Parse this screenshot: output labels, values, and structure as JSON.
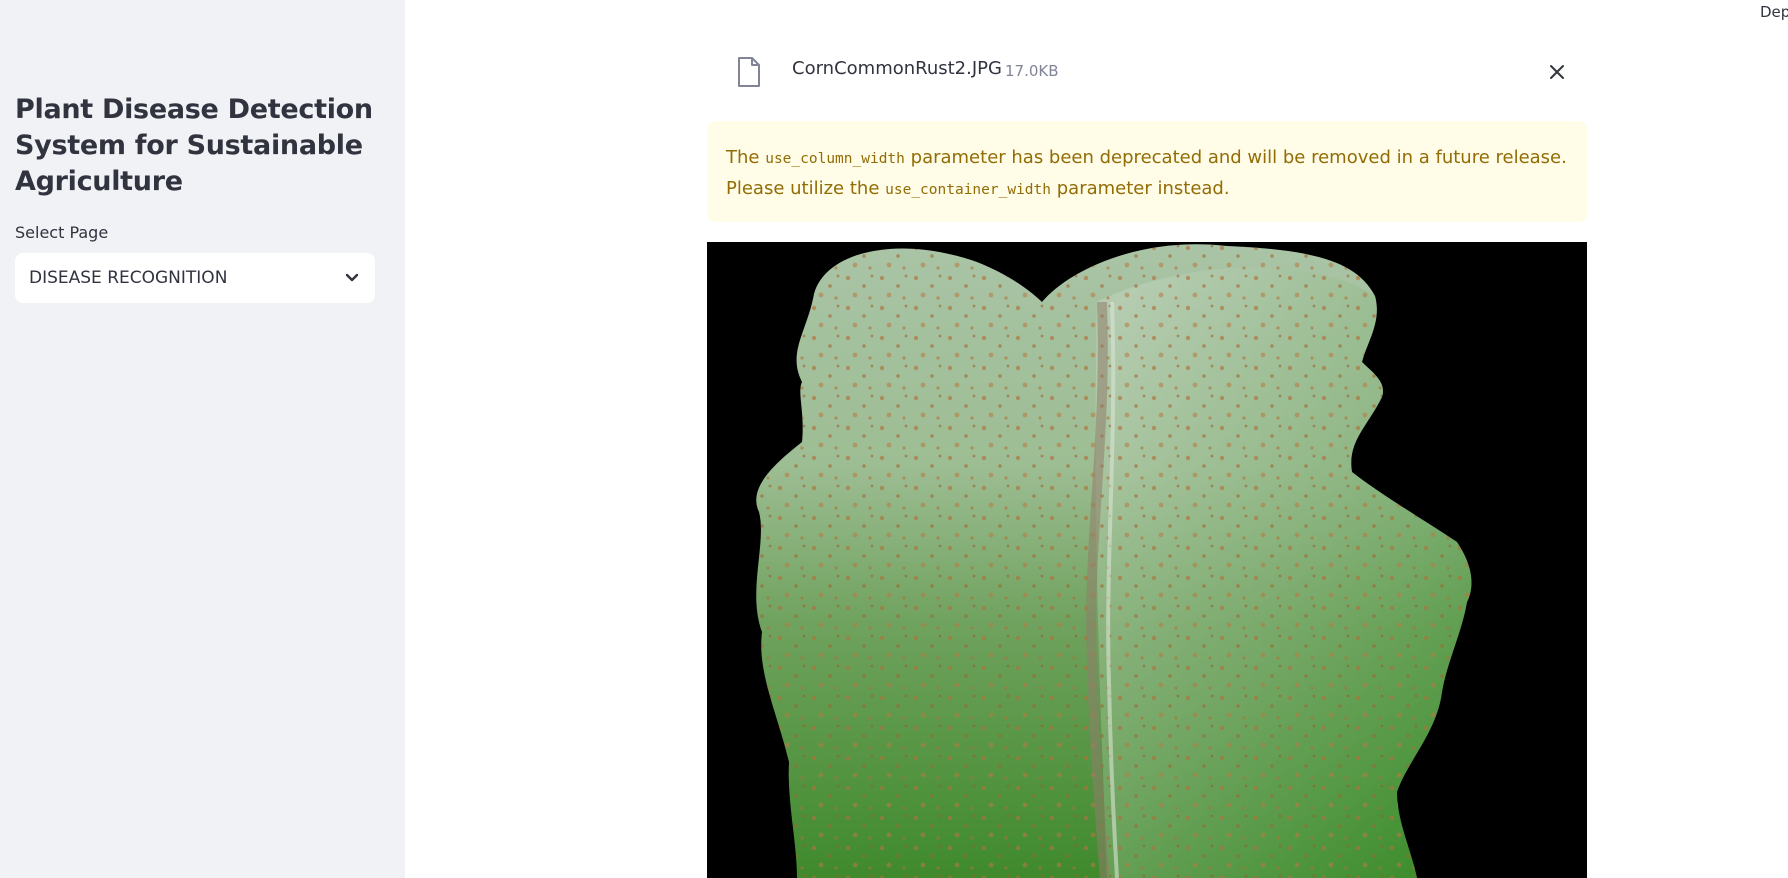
{
  "sidebar": {
    "title": "Plant Disease Detection System for Sustainable Agriculture",
    "select_label": "Select Page",
    "selected_page": "DISEASE RECOGNITION"
  },
  "header": {
    "deploy_label": "Deploy"
  },
  "uploaded_file": {
    "name": "CornCommonRust2.JPG",
    "size": "17.0KB"
  },
  "warning": {
    "part1": "The",
    "code1": "use_column_width",
    "part2": "parameter has been deprecated and will be removed in a future release. Please utilize the",
    "code2": "use_container_width",
    "part3": "parameter instead."
  },
  "colors": {
    "sidebar_bg": "#f0f2f6",
    "warning_bg": "#fffce7",
    "warning_text": "#926c05",
    "text": "#31333f"
  },
  "icons": [
    "file-icon",
    "close-icon",
    "chevron-down-icon"
  ]
}
